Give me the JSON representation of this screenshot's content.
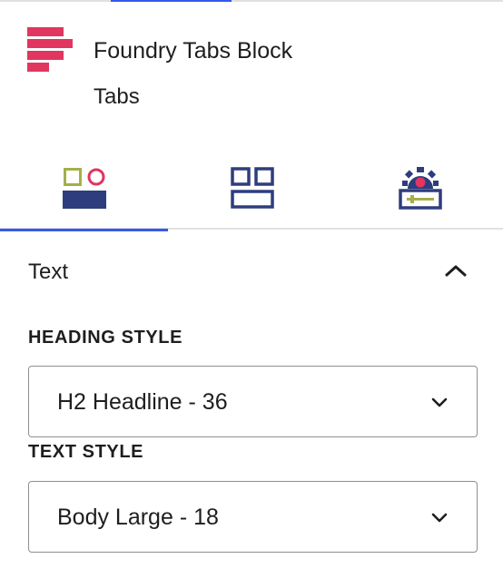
{
  "block": {
    "name": "Foundry Tabs Block",
    "description": "Tabs",
    "logo_icon": "foundry-logo-icon"
  },
  "tabs": [
    {
      "icon": "style-icon",
      "active": true
    },
    {
      "icon": "layout-icon",
      "active": false
    },
    {
      "icon": "settings-icon",
      "active": false
    }
  ],
  "panel": {
    "title": "Text",
    "expanded": true
  },
  "heading_style": {
    "label": "HEADING STYLE",
    "value": "H2 Headline - 36"
  },
  "text_style": {
    "label": "TEXT STYLE",
    "value": "Body Large - 18"
  },
  "colors": {
    "accent": "#3858e9",
    "brand_pink": "#e0365f",
    "navy": "#2e3d7d",
    "olive": "#a3b04a"
  }
}
